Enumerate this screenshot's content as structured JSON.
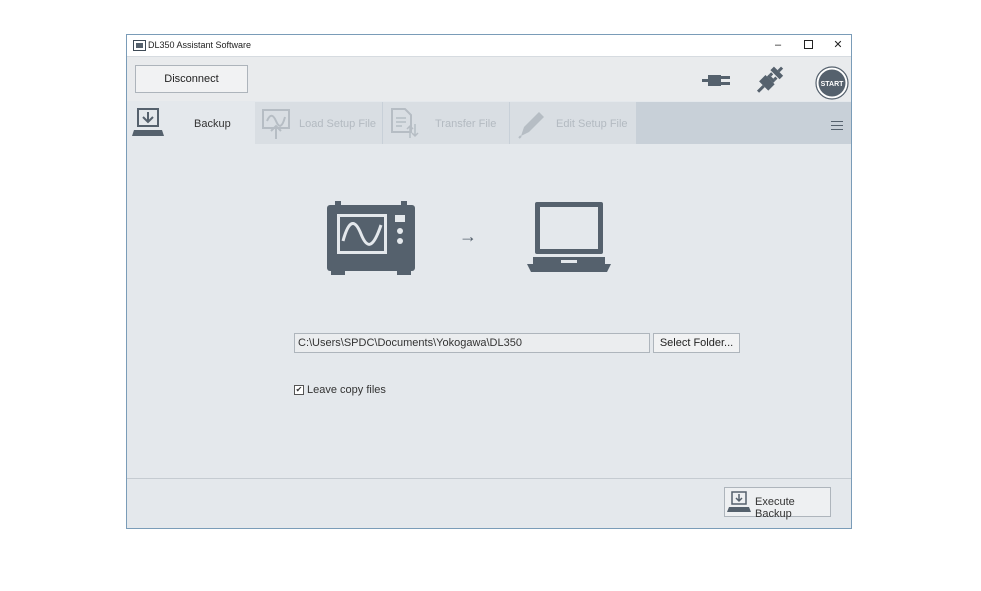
{
  "window": {
    "title": "DL350 Assistant Software"
  },
  "window_controls": {
    "minimize": "–",
    "close": "✕"
  },
  "toolbar": {
    "disconnect_label": "Disconnect",
    "start_label": "START"
  },
  "tabs": [
    {
      "label": "Backup",
      "icon": "backup-icon",
      "state": "active"
    },
    {
      "label": "Load Setup File",
      "icon": "load-setup-icon",
      "state": "disabled"
    },
    {
      "label": "Transfer File",
      "icon": "transfer-file-icon",
      "state": "disabled"
    },
    {
      "label": "Edit Setup File",
      "icon": "edit-pencil-icon",
      "state": "disabled"
    }
  ],
  "main": {
    "arrow": "→",
    "folder_path": "C:\\Users\\SPDC\\Documents\\Yokogawa\\DL350",
    "select_folder_label": "Select Folder...",
    "leave_copy_label": "Leave copy files",
    "leave_copy_checked": true,
    "checkmark": "✔"
  },
  "footer": {
    "execute_label": "Execute Backup"
  },
  "colors": {
    "icon": "#55616d",
    "tab_bar": "#c8d0d8",
    "panel": "#e4e8ec",
    "disabled_text": "#b3bac1"
  }
}
